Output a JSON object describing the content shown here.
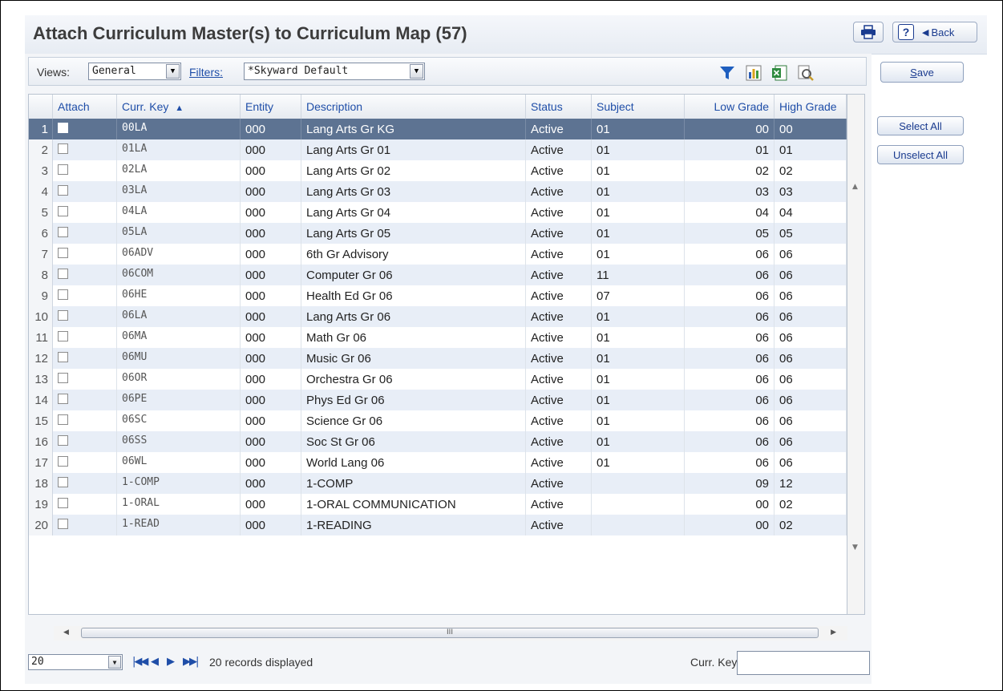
{
  "header": {
    "title": "Attach Curriculum Master(s) to Curriculum Map (57)",
    "help_label": "?",
    "back_label": "Back"
  },
  "toolbar": {
    "views_label": "Views:",
    "views_value": "General",
    "filters_label": "Filters:",
    "filters_value": "*Skyward Default",
    "icons": [
      "filter-icon",
      "chart-icon",
      "excel-export-icon",
      "print-preview-icon"
    ]
  },
  "actions": {
    "save_label": "Save",
    "save_accesskey": "S",
    "save_rest": "ave",
    "select_all_label": "Select All",
    "unselect_all_label": "Unselect All"
  },
  "grid": {
    "columns": [
      "Attach",
      "Curr. Key",
      "Entity",
      "Description",
      "Status",
      "Subject",
      "Low Grade",
      "High Grade"
    ],
    "sort_indicator": "▲",
    "rows": [
      {
        "num": "1",
        "key": "00LA",
        "entity": "000",
        "desc": "Lang Arts Gr KG",
        "status": "Active",
        "subject": "01",
        "low": "00",
        "high": "00"
      },
      {
        "num": "2",
        "key": "01LA",
        "entity": "000",
        "desc": "Lang Arts Gr 01",
        "status": "Active",
        "subject": "01",
        "low": "01",
        "high": "01"
      },
      {
        "num": "3",
        "key": "02LA",
        "entity": "000",
        "desc": "Lang Arts Gr 02",
        "status": "Active",
        "subject": "01",
        "low": "02",
        "high": "02"
      },
      {
        "num": "4",
        "key": "03LA",
        "entity": "000",
        "desc": "Lang Arts Gr 03",
        "status": "Active",
        "subject": "01",
        "low": "03",
        "high": "03"
      },
      {
        "num": "5",
        "key": "04LA",
        "entity": "000",
        "desc": "Lang Arts Gr 04",
        "status": "Active",
        "subject": "01",
        "low": "04",
        "high": "04"
      },
      {
        "num": "6",
        "key": "05LA",
        "entity": "000",
        "desc": "Lang Arts Gr 05",
        "status": "Active",
        "subject": "01",
        "low": "05",
        "high": "05"
      },
      {
        "num": "7",
        "key": "06ADV",
        "entity": "000",
        "desc": "6th Gr Advisory",
        "status": "Active",
        "subject": "01",
        "low": "06",
        "high": "06"
      },
      {
        "num": "8",
        "key": "06COM",
        "entity": "000",
        "desc": "Computer Gr 06",
        "status": "Active",
        "subject": "11",
        "low": "06",
        "high": "06"
      },
      {
        "num": "9",
        "key": "06HE",
        "entity": "000",
        "desc": "Health Ed Gr 06",
        "status": "Active",
        "subject": "07",
        "low": "06",
        "high": "06"
      },
      {
        "num": "10",
        "key": "06LA",
        "entity": "000",
        "desc": "Lang Arts Gr 06",
        "status": "Active",
        "subject": "01",
        "low": "06",
        "high": "06"
      },
      {
        "num": "11",
        "key": "06MA",
        "entity": "000",
        "desc": "Math Gr 06",
        "status": "Active",
        "subject": "01",
        "low": "06",
        "high": "06"
      },
      {
        "num": "12",
        "key": "06MU",
        "entity": "000",
        "desc": "Music Gr 06",
        "status": "Active",
        "subject": "01",
        "low": "06",
        "high": "06"
      },
      {
        "num": "13",
        "key": "06OR",
        "entity": "000",
        "desc": "Orchestra Gr 06",
        "status": "Active",
        "subject": "01",
        "low": "06",
        "high": "06"
      },
      {
        "num": "14",
        "key": "06PE",
        "entity": "000",
        "desc": "Phys Ed Gr 06",
        "status": "Active",
        "subject": "01",
        "low": "06",
        "high": "06"
      },
      {
        "num": "15",
        "key": "06SC",
        "entity": "000",
        "desc": "Science Gr 06",
        "status": "Active",
        "subject": "01",
        "low": "06",
        "high": "06"
      },
      {
        "num": "16",
        "key": "06SS",
        "entity": "000",
        "desc": "Soc St Gr 06",
        "status": "Active",
        "subject": "01",
        "low": "06",
        "high": "06"
      },
      {
        "num": "17",
        "key": "06WL",
        "entity": "000",
        "desc": "World Lang 06",
        "status": "Active",
        "subject": "01",
        "low": "06",
        "high": "06"
      },
      {
        "num": "18",
        "key": "1-COMP",
        "entity": "000",
        "desc": "1-COMP",
        "status": "Active",
        "subject": "",
        "low": "09",
        "high": "12"
      },
      {
        "num": "19",
        "key": "1-ORAL",
        "entity": "000",
        "desc": "1-ORAL COMMUNICATION",
        "status": "Active",
        "subject": "",
        "low": "00",
        "high": "02"
      },
      {
        "num": "20",
        "key": "1-READ",
        "entity": "000",
        "desc": "1-READING",
        "status": "Active",
        "subject": "",
        "low": "00",
        "high": "02"
      }
    ]
  },
  "footer": {
    "page_size": "20",
    "records_text": "20 records displayed",
    "curr_key_label": "Curr. Key:",
    "curr_key_value": ""
  }
}
